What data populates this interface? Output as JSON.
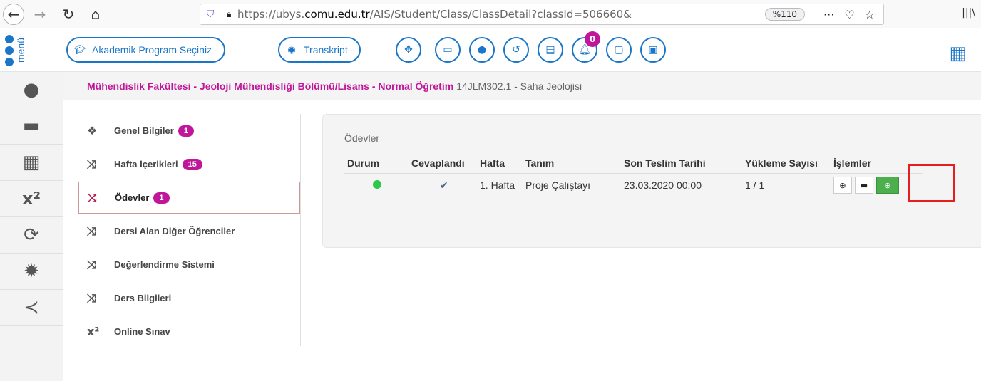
{
  "browser": {
    "url_prefix": "https://ubys.",
    "url_domain": "comu.edu.tr",
    "url_path": "/AIS/Student/Class/ClassDetail?classId=506660&",
    "zoom": "%110"
  },
  "topbar": {
    "menu_label": "menü",
    "program_label": "Akademik Program Seçiniz",
    "transcript_label": "Transkript",
    "notification_count": "0"
  },
  "breadcrumb": {
    "main": "Mühendislik Fakültesi - Jeoloji Mühendisliği Bölümü/Lisans - Normal Öğretim",
    "sub": "14JLM302.1 - Saha Jeolojisi"
  },
  "subnav": {
    "items": [
      {
        "label": "Genel Bilgiler",
        "badge": "1"
      },
      {
        "label": "Hafta İçerikleri",
        "badge": "15"
      },
      {
        "label": "Ödevler",
        "badge": "1"
      },
      {
        "label": "Dersi Alan Diğer Öğrenciler"
      },
      {
        "label": "Değerlendirme Sistemi"
      },
      {
        "label": "Ders Bilgileri"
      },
      {
        "label": "Online Sınav"
      }
    ]
  },
  "assignments": {
    "title": "Ödevler",
    "headers": [
      "Durum",
      "Cevaplandı",
      "Hafta",
      "Tanım",
      "Son Teslim Tarihi",
      "Yükleme Sayısı",
      "İşlemler"
    ],
    "rows": [
      {
        "week": "1. Hafta",
        "description": "Proje Çalıştayı",
        "deadline": "23.03.2020 00:00",
        "uploads": "1 / 1"
      }
    ]
  }
}
